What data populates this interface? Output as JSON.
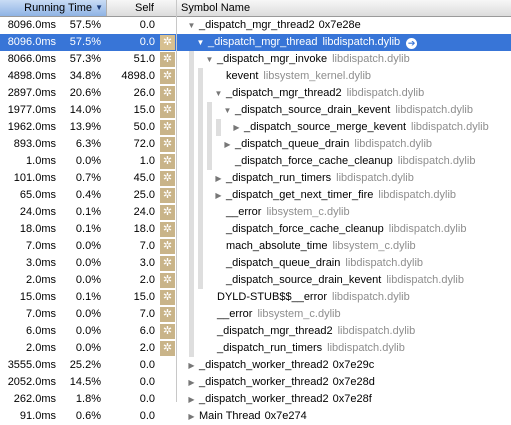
{
  "header": {
    "running_time": "Running Time",
    "self": "Self",
    "symbol_name": "Symbol Name"
  },
  "rows": [
    {
      "ms": "8096.0ms",
      "pct": "57.5%",
      "self": "0.0",
      "gear": false,
      "depth": 0,
      "expander": "down",
      "name": "_dispatch_mgr_thread2",
      "lib": "",
      "addr": "0x7e28e",
      "selected": false,
      "go": false
    },
    {
      "ms": "8096.0ms",
      "pct": "57.5%",
      "self": "0.0",
      "gear": true,
      "depth": 1,
      "expander": "down",
      "name": "_dispatch_mgr_thread",
      "lib": "libdispatch.dylib",
      "addr": "",
      "selected": true,
      "go": true
    },
    {
      "ms": "8066.0ms",
      "pct": "57.3%",
      "self": "51.0",
      "gear": true,
      "depth": 2,
      "expander": "down",
      "name": "_dispatch_mgr_invoke",
      "lib": "libdispatch.dylib",
      "addr": "",
      "selected": false,
      "go": false
    },
    {
      "ms": "4898.0ms",
      "pct": "34.8%",
      "self": "4898.0",
      "gear": true,
      "depth": 3,
      "expander": "none",
      "name": "kevent",
      "lib": "libsystem_kernel.dylib",
      "addr": "",
      "selected": false,
      "go": false
    },
    {
      "ms": "2897.0ms",
      "pct": "20.6%",
      "self": "26.0",
      "gear": true,
      "depth": 3,
      "expander": "down",
      "name": "_dispatch_mgr_thread2",
      "lib": "libdispatch.dylib",
      "addr": "",
      "selected": false,
      "go": false
    },
    {
      "ms": "1977.0ms",
      "pct": "14.0%",
      "self": "15.0",
      "gear": true,
      "depth": 4,
      "expander": "down",
      "name": "_dispatch_source_drain_kevent",
      "lib": "libdispatch.dylib",
      "addr": "",
      "selected": false,
      "go": false
    },
    {
      "ms": "1962.0ms",
      "pct": "13.9%",
      "self": "50.0",
      "gear": true,
      "depth": 5,
      "expander": "right",
      "name": "_dispatch_source_merge_kevent",
      "lib": "libdispatch.dylib",
      "addr": "",
      "selected": false,
      "go": false
    },
    {
      "ms": "893.0ms",
      "pct": "6.3%",
      "self": "72.0",
      "gear": true,
      "depth": 4,
      "expander": "right",
      "name": "_dispatch_queue_drain",
      "lib": "libdispatch.dylib",
      "addr": "",
      "selected": false,
      "go": false
    },
    {
      "ms": "1.0ms",
      "pct": "0.0%",
      "self": "1.0",
      "gear": true,
      "depth": 4,
      "expander": "none",
      "name": "_dispatch_force_cache_cleanup",
      "lib": "libdispatch.dylib",
      "addr": "",
      "selected": false,
      "go": false
    },
    {
      "ms": "101.0ms",
      "pct": "0.7%",
      "self": "45.0",
      "gear": true,
      "depth": 3,
      "expander": "right",
      "name": "_dispatch_run_timers",
      "lib": "libdispatch.dylib",
      "addr": "",
      "selected": false,
      "go": false
    },
    {
      "ms": "65.0ms",
      "pct": "0.4%",
      "self": "25.0",
      "gear": true,
      "depth": 3,
      "expander": "right",
      "name": "_dispatch_get_next_timer_fire",
      "lib": "libdispatch.dylib",
      "addr": "",
      "selected": false,
      "go": false
    },
    {
      "ms": "24.0ms",
      "pct": "0.1%",
      "self": "24.0",
      "gear": true,
      "depth": 3,
      "expander": "none",
      "name": "__error",
      "lib": "libsystem_c.dylib",
      "addr": "",
      "selected": false,
      "go": false
    },
    {
      "ms": "18.0ms",
      "pct": "0.1%",
      "self": "18.0",
      "gear": true,
      "depth": 3,
      "expander": "none",
      "name": "_dispatch_force_cache_cleanup",
      "lib": "libdispatch.dylib",
      "addr": "",
      "selected": false,
      "go": false
    },
    {
      "ms": "7.0ms",
      "pct": "0.0%",
      "self": "7.0",
      "gear": true,
      "depth": 3,
      "expander": "none",
      "name": "mach_absolute_time",
      "lib": "libsystem_c.dylib",
      "addr": "",
      "selected": false,
      "go": false
    },
    {
      "ms": "3.0ms",
      "pct": "0.0%",
      "self": "3.0",
      "gear": true,
      "depth": 3,
      "expander": "none",
      "name": "_dispatch_queue_drain",
      "lib": "libdispatch.dylib",
      "addr": "",
      "selected": false,
      "go": false
    },
    {
      "ms": "2.0ms",
      "pct": "0.0%",
      "self": "2.0",
      "gear": true,
      "depth": 3,
      "expander": "none",
      "name": "_dispatch_source_drain_kevent",
      "lib": "libdispatch.dylib",
      "addr": "",
      "selected": false,
      "go": false
    },
    {
      "ms": "15.0ms",
      "pct": "0.1%",
      "self": "15.0",
      "gear": true,
      "depth": 2,
      "expander": "none",
      "name": "DYLD-STUB$$__error",
      "lib": "libdispatch.dylib",
      "addr": "",
      "selected": false,
      "go": false
    },
    {
      "ms": "7.0ms",
      "pct": "0.0%",
      "self": "7.0",
      "gear": true,
      "depth": 2,
      "expander": "none",
      "name": "__error",
      "lib": "libsystem_c.dylib",
      "addr": "",
      "selected": false,
      "go": false
    },
    {
      "ms": "6.0ms",
      "pct": "0.0%",
      "self": "6.0",
      "gear": true,
      "depth": 2,
      "expander": "none",
      "name": "_dispatch_mgr_thread2",
      "lib": "libdispatch.dylib",
      "addr": "",
      "selected": false,
      "go": false
    },
    {
      "ms": "2.0ms",
      "pct": "0.0%",
      "self": "2.0",
      "gear": true,
      "depth": 2,
      "expander": "none",
      "name": "_dispatch_run_timers",
      "lib": "libdispatch.dylib",
      "addr": "",
      "selected": false,
      "go": false
    },
    {
      "ms": "3555.0ms",
      "pct": "25.2%",
      "self": "0.0",
      "gear": false,
      "depth": 0,
      "expander": "right",
      "name": "_dispatch_worker_thread2",
      "lib": "",
      "addr": "0x7e29c",
      "selected": false,
      "go": false
    },
    {
      "ms": "2052.0ms",
      "pct": "14.5%",
      "self": "0.0",
      "gear": false,
      "depth": 0,
      "expander": "right",
      "name": "_dispatch_worker_thread2",
      "lib": "",
      "addr": "0x7e28d",
      "selected": false,
      "go": false
    },
    {
      "ms": "262.0ms",
      "pct": "1.8%",
      "self": "0.0",
      "gear": false,
      "depth": 0,
      "expander": "right",
      "name": "_dispatch_worker_thread2",
      "lib": "",
      "addr": "0x7e28f",
      "selected": false,
      "go": false
    },
    {
      "ms": "91.0ms",
      "pct": "0.6%",
      "self": "0.0",
      "gear": false,
      "depth": 0,
      "expander": "right",
      "name": "Main Thread",
      "lib": "",
      "addr": "0x7e274",
      "selected": false,
      "go": false
    }
  ],
  "colors": {
    "selection": "#3875d7",
    "gear_button": "#c9b489",
    "library_text": "#8e8e8e"
  },
  "icons": {
    "expander_down": "▼",
    "expander_right": "▶",
    "gear": "✲",
    "go": "➔"
  }
}
